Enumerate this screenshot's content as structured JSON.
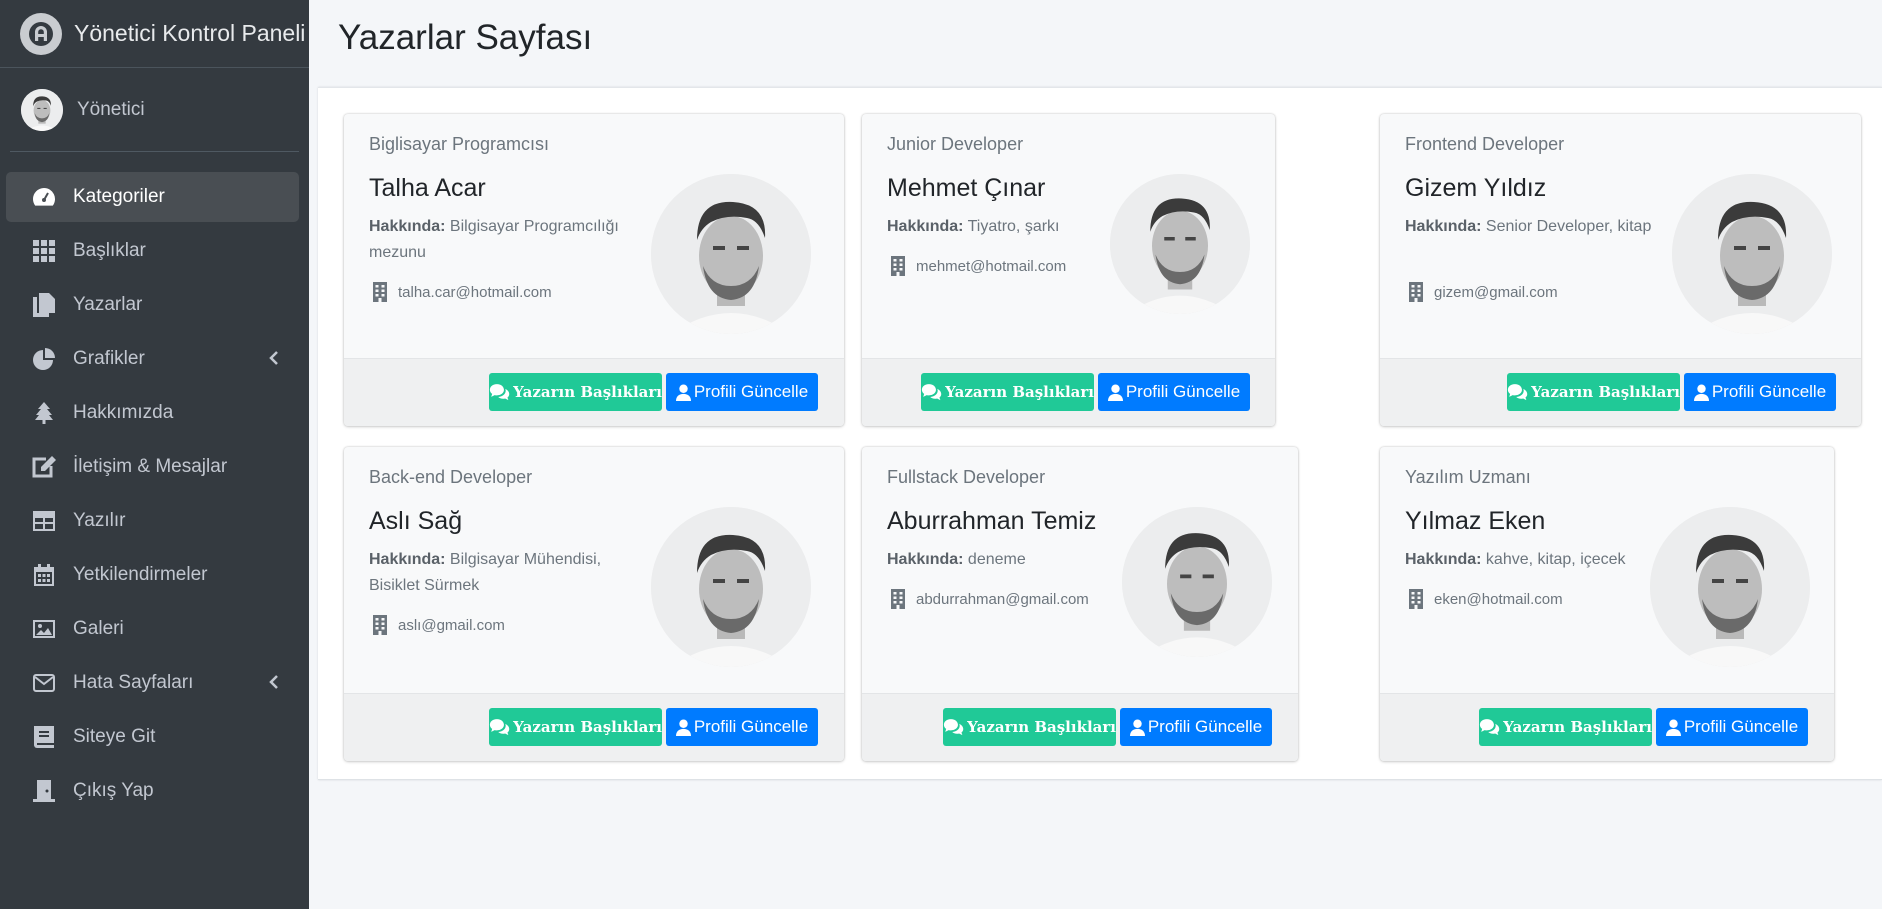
{
  "brand": {
    "title": "Yönetici Kontrol Paneli"
  },
  "user": {
    "name": "Yönetici"
  },
  "sidebar": {
    "items": [
      {
        "label": "Kategoriler",
        "icon": "tachometer-icon"
      },
      {
        "label": "Başlıklar",
        "icon": "grid-icon"
      },
      {
        "label": "Yazarlar",
        "icon": "copy-icon"
      },
      {
        "label": "Grafikler",
        "icon": "pie-chart-icon"
      },
      {
        "label": "Hakkımızda",
        "icon": "tree-icon"
      },
      {
        "label": "İletişim & Mesajlar",
        "icon": "edit-icon"
      },
      {
        "label": "Yazılır",
        "icon": "table-icon"
      },
      {
        "label": "Yetkilendirmeler",
        "icon": "calendar-icon"
      },
      {
        "label": "Galeri",
        "icon": "image-icon"
      },
      {
        "label": "Hata Sayfaları",
        "icon": "envelope-icon"
      },
      {
        "label": "Siteye Git",
        "icon": "book-icon"
      },
      {
        "label": "Çıkış Yap",
        "icon": "door-icon"
      }
    ]
  },
  "page": {
    "title": "Yazarlar Sayfası"
  },
  "labels": {
    "about": "Hakkında:",
    "titles_button": "Yazarın Başlıkları",
    "update_button": "Profili Güncelle"
  },
  "writers": [
    {
      "role": "Biglisayar Programcısı",
      "name": "Talha Acar",
      "about": "Bilgisayar Programcılığı mezunu",
      "email": "talha.car@hotmail.com"
    },
    {
      "role": "Junior Developer",
      "name": "Mehmet Çınar",
      "about": "Tiyatro, şarkı",
      "email": "mehmet@hotmail.com"
    },
    {
      "role": "Frontend Developer",
      "name": "Gizem Yıldız",
      "about": "Senior Developer, kitap",
      "email": "gizem@gmail.com"
    },
    {
      "role": "Back-end Developer",
      "name": "Aslı Sağ",
      "about": "Bilgisayar Mühendisi, Bisiklet Sürmek",
      "email": "aslı@gmail.com"
    },
    {
      "role": "Fullstack Developer",
      "name": "Aburrahman Temiz",
      "about": "deneme",
      "email": "abdurrahman@gmail.com"
    },
    {
      "role": "Yazılım Uzmanı",
      "name": "Yılmaz Eken",
      "about": "kahve, kitap, içecek",
      "email": "eken@hotmail.com"
    }
  ],
  "colors": {
    "sidebar": "#343a40",
    "active_item": "#494e53",
    "green_button": "#20c997",
    "blue_button": "#007bff",
    "background": "#f4f6f9"
  }
}
